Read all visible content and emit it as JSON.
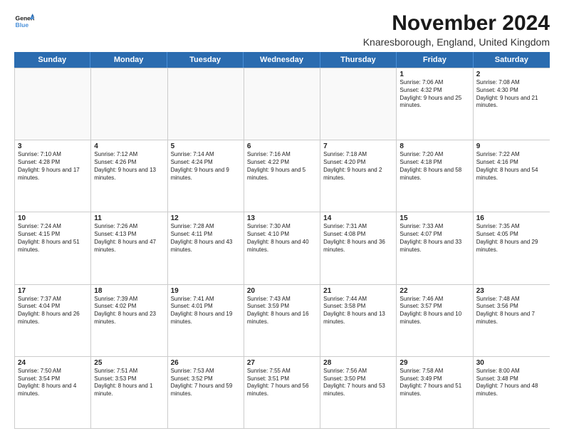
{
  "logo": {
    "line1": "General",
    "line2": "Blue"
  },
  "title": "November 2024",
  "subtitle": "Knaresborough, England, United Kingdom",
  "header": {
    "days": [
      "Sunday",
      "Monday",
      "Tuesday",
      "Wednesday",
      "Thursday",
      "Friday",
      "Saturday"
    ]
  },
  "rows": [
    [
      {
        "day": "",
        "empty": true
      },
      {
        "day": "",
        "empty": true
      },
      {
        "day": "",
        "empty": true
      },
      {
        "day": "",
        "empty": true
      },
      {
        "day": "",
        "empty": true
      },
      {
        "day": "1",
        "text": "Sunrise: 7:06 AM\nSunset: 4:32 PM\nDaylight: 9 hours and 25 minutes."
      },
      {
        "day": "2",
        "text": "Sunrise: 7:08 AM\nSunset: 4:30 PM\nDaylight: 9 hours and 21 minutes."
      }
    ],
    [
      {
        "day": "3",
        "text": "Sunrise: 7:10 AM\nSunset: 4:28 PM\nDaylight: 9 hours and 17 minutes."
      },
      {
        "day": "4",
        "text": "Sunrise: 7:12 AM\nSunset: 4:26 PM\nDaylight: 9 hours and 13 minutes."
      },
      {
        "day": "5",
        "text": "Sunrise: 7:14 AM\nSunset: 4:24 PM\nDaylight: 9 hours and 9 minutes."
      },
      {
        "day": "6",
        "text": "Sunrise: 7:16 AM\nSunset: 4:22 PM\nDaylight: 9 hours and 5 minutes."
      },
      {
        "day": "7",
        "text": "Sunrise: 7:18 AM\nSunset: 4:20 PM\nDaylight: 9 hours and 2 minutes."
      },
      {
        "day": "8",
        "text": "Sunrise: 7:20 AM\nSunset: 4:18 PM\nDaylight: 8 hours and 58 minutes."
      },
      {
        "day": "9",
        "text": "Sunrise: 7:22 AM\nSunset: 4:16 PM\nDaylight: 8 hours and 54 minutes."
      }
    ],
    [
      {
        "day": "10",
        "text": "Sunrise: 7:24 AM\nSunset: 4:15 PM\nDaylight: 8 hours and 51 minutes."
      },
      {
        "day": "11",
        "text": "Sunrise: 7:26 AM\nSunset: 4:13 PM\nDaylight: 8 hours and 47 minutes."
      },
      {
        "day": "12",
        "text": "Sunrise: 7:28 AM\nSunset: 4:11 PM\nDaylight: 8 hours and 43 minutes."
      },
      {
        "day": "13",
        "text": "Sunrise: 7:30 AM\nSunset: 4:10 PM\nDaylight: 8 hours and 40 minutes."
      },
      {
        "day": "14",
        "text": "Sunrise: 7:31 AM\nSunset: 4:08 PM\nDaylight: 8 hours and 36 minutes."
      },
      {
        "day": "15",
        "text": "Sunrise: 7:33 AM\nSunset: 4:07 PM\nDaylight: 8 hours and 33 minutes."
      },
      {
        "day": "16",
        "text": "Sunrise: 7:35 AM\nSunset: 4:05 PM\nDaylight: 8 hours and 29 minutes."
      }
    ],
    [
      {
        "day": "17",
        "text": "Sunrise: 7:37 AM\nSunset: 4:04 PM\nDaylight: 8 hours and 26 minutes."
      },
      {
        "day": "18",
        "text": "Sunrise: 7:39 AM\nSunset: 4:02 PM\nDaylight: 8 hours and 23 minutes."
      },
      {
        "day": "19",
        "text": "Sunrise: 7:41 AM\nSunset: 4:01 PM\nDaylight: 8 hours and 19 minutes."
      },
      {
        "day": "20",
        "text": "Sunrise: 7:43 AM\nSunset: 3:59 PM\nDaylight: 8 hours and 16 minutes."
      },
      {
        "day": "21",
        "text": "Sunrise: 7:44 AM\nSunset: 3:58 PM\nDaylight: 8 hours and 13 minutes."
      },
      {
        "day": "22",
        "text": "Sunrise: 7:46 AM\nSunset: 3:57 PM\nDaylight: 8 hours and 10 minutes."
      },
      {
        "day": "23",
        "text": "Sunrise: 7:48 AM\nSunset: 3:56 PM\nDaylight: 8 hours and 7 minutes."
      }
    ],
    [
      {
        "day": "24",
        "text": "Sunrise: 7:50 AM\nSunset: 3:54 PM\nDaylight: 8 hours and 4 minutes."
      },
      {
        "day": "25",
        "text": "Sunrise: 7:51 AM\nSunset: 3:53 PM\nDaylight: 8 hours and 1 minute."
      },
      {
        "day": "26",
        "text": "Sunrise: 7:53 AM\nSunset: 3:52 PM\nDaylight: 7 hours and 59 minutes."
      },
      {
        "day": "27",
        "text": "Sunrise: 7:55 AM\nSunset: 3:51 PM\nDaylight: 7 hours and 56 minutes."
      },
      {
        "day": "28",
        "text": "Sunrise: 7:56 AM\nSunset: 3:50 PM\nDaylight: 7 hours and 53 minutes."
      },
      {
        "day": "29",
        "text": "Sunrise: 7:58 AM\nSunset: 3:49 PM\nDaylight: 7 hours and 51 minutes."
      },
      {
        "day": "30",
        "text": "Sunrise: 8:00 AM\nSunset: 3:48 PM\nDaylight: 7 hours and 48 minutes."
      }
    ]
  ]
}
